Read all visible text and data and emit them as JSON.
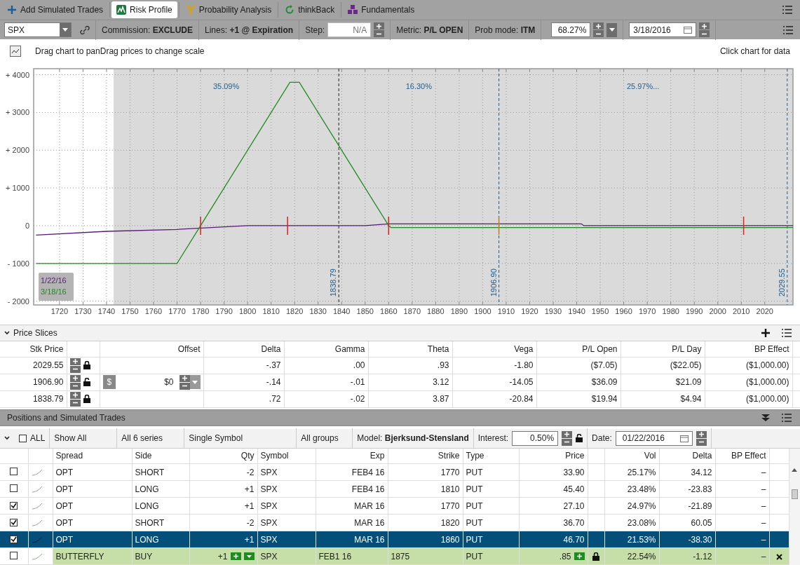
{
  "tabs": [
    {
      "label": "Add Simulated Trades",
      "selected": false
    },
    {
      "label": "Risk Profile",
      "selected": true
    },
    {
      "label": "Probability Analysis",
      "selected": false
    },
    {
      "label": "thinkBack",
      "selected": false
    },
    {
      "label": "Fundamentals",
      "selected": false
    }
  ],
  "toolbar": {
    "symbol": "SPX",
    "commission": {
      "label": "Commission:",
      "value": "EXCLUDE"
    },
    "lines": {
      "label": "Lines:",
      "value": "+1 @ Expiration"
    },
    "step": {
      "label": "Step:",
      "placeholder": "N/A"
    },
    "metric": {
      "label": "Metric:",
      "value": "P/L OPEN"
    },
    "prob_mode": {
      "label": "Prob mode:",
      "value": "ITM"
    },
    "probability": "68.27%",
    "date": "3/18/2016"
  },
  "chart_hint": "Drag chart to panDrag prices to change scale",
  "chart_click_hint": "Click chart for data",
  "chart": {
    "chart_data": {
      "type": "line",
      "grid": true,
      "xlim": [
        1709,
        2032
      ],
      "ylim": [
        -2100,
        4160
      ],
      "xticks": [
        1720,
        1730,
        1740,
        1750,
        1760,
        1770,
        1780,
        1790,
        1800,
        1810,
        1820,
        1830,
        1840,
        1850,
        1860,
        1870,
        1880,
        1890,
        1900,
        1910,
        1920,
        1930,
        1940,
        1950,
        1960,
        1970,
        1980,
        1990,
        2000,
        2010,
        2020
      ],
      "yticks": [
        {
          "value": 4000,
          "label": "+ 4000"
        },
        {
          "value": 3000,
          "label": "+ 3000"
        },
        {
          "value": 2000,
          "label": "+ 2000"
        },
        {
          "value": 1000,
          "label": "+ 1000"
        },
        {
          "value": 0,
          "label": "0"
        },
        {
          "value": -1000,
          "label": "- 1000"
        },
        {
          "value": -2000,
          "label": "- 2000"
        }
      ],
      "series": [
        {
          "name": "1/22/16",
          "color": "#5a1a7a",
          "x": [
            1710,
            1740,
            1770,
            1800,
            1820,
            1850,
            1860,
            1942,
            1943,
            1987,
            1988,
            2032
          ],
          "values": [
            -250,
            -150,
            -100,
            0,
            0,
            0,
            50,
            50,
            0,
            0,
            0,
            0
          ]
        },
        {
          "name": "3/18/16",
          "color": "#1e8c1e",
          "x": [
            1710,
            1768,
            1770,
            1780,
            1818,
            1822,
            1860,
            1861,
            2032
          ],
          "values": [
            -1000,
            -1000,
            -1000,
            0,
            3800,
            3800,
            0,
            -50,
            -50
          ]
        }
      ],
      "bands": [
        {
          "axis": "x",
          "from": 1743,
          "to": 2032,
          "color": "#dadada"
        }
      ],
      "ref_lines": [
        {
          "axis": "x",
          "value": 1838.79,
          "label": "1838.79",
          "color": "#222222"
        },
        {
          "axis": "x",
          "value": 1906.9,
          "label": "1906.90",
          "color": "#1f5f8f"
        },
        {
          "axis": "x",
          "value": 2029.55,
          "label": "2029.55",
          "color": "#1f5f8f"
        }
      ],
      "annotations": [
        "35.09%",
        "16.30%",
        "25.97%..."
      ]
    }
  },
  "price_slices": {
    "title": "Price Slices",
    "expanded": true,
    "columns": [
      "Stk Price",
      "Offset",
      "Delta",
      "Gamma",
      "Theta",
      "Vega",
      "P/L Open",
      "P/L Day",
      "BP Effect"
    ],
    "rows": [
      {
        "stk_price": "2029.55",
        "locked": true,
        "values": [
          "-.37",
          ".00",
          ".93",
          "-1.80",
          "($7.05)",
          "($22.05)",
          "($1,000.00)"
        ]
      },
      {
        "stk_price": "1906.90",
        "locked": false,
        "offset": {
          "unit": "$",
          "value": "$0"
        },
        "values": [
          "-.14",
          "-.01",
          "3.12",
          "-14.05",
          "$36.09",
          "$21.09",
          "($1,000.00)"
        ]
      },
      {
        "stk_price": "1838.79",
        "locked": true,
        "values": [
          ".72",
          "-.02",
          "3.87",
          "-20.84",
          "$19.94",
          "$4.94",
          "($1,000.00)"
        ]
      }
    ]
  },
  "positions": {
    "title": "Positions and Simulated Trades",
    "filters": {
      "all_label": "ALL",
      "all_checked": false,
      "show": "Show All",
      "series": "All 6 series",
      "symbol_mode": "Single Symbol",
      "groups": "All groups",
      "model": "Model: **Bjerksund-Stensland**",
      "interest": {
        "label": "Interest:",
        "value": "0.50%",
        "locked": false
      },
      "date": {
        "label": "Date:",
        "value": "01/22/2016"
      }
    },
    "columns": [
      "Spread",
      "Side",
      "Qty",
      "Symbol",
      "Exp",
      "Strike",
      "Type",
      "Price",
      "Vol",
      "Delta",
      "BP Effect"
    ],
    "rows": [
      {
        "kind": "position",
        "checked": false,
        "selected": false,
        "cells": [
          "OPT",
          "SHORT",
          "-2",
          "SPX",
          "FEB4 16",
          "1770",
          "PUT",
          "33.90",
          "25.17%",
          "34.12",
          "–"
        ]
      },
      {
        "kind": "position",
        "checked": false,
        "selected": false,
        "cells": [
          "OPT",
          "LONG",
          "+1",
          "SPX",
          "FEB4 16",
          "1810",
          "PUT",
          "45.40",
          "23.48%",
          "-23.83",
          "–"
        ]
      },
      {
        "kind": "position",
        "checked": true,
        "selected": false,
        "cells": [
          "OPT",
          "LONG",
          "+1",
          "SPX",
          "MAR 16",
          "1770",
          "PUT",
          "27.10",
          "24.97%",
          "-21.89",
          "–"
        ]
      },
      {
        "kind": "position",
        "checked": true,
        "selected": false,
        "cells": [
          "OPT",
          "SHORT",
          "-2",
          "SPX",
          "MAR 16",
          "1820",
          "PUT",
          "36.70",
          "23.08%",
          "60.05",
          "–"
        ]
      },
      {
        "kind": "position",
        "checked": true,
        "selected": true,
        "cells": [
          "OPT",
          "LONG",
          "+1",
          "SPX",
          "MAR 16",
          "1860",
          "PUT",
          "46.70",
          "21.53%",
          "-38.30",
          "–"
        ]
      },
      {
        "kind": "simulated",
        "checked": false,
        "selected": false,
        "cells": [
          "BUTTERFLY",
          "BUY",
          "+1",
          "SPX",
          "FEB1 16",
          "1875",
          "PUT",
          ".85",
          "22.54%",
          "-1.12",
          "–"
        ]
      }
    ]
  }
}
